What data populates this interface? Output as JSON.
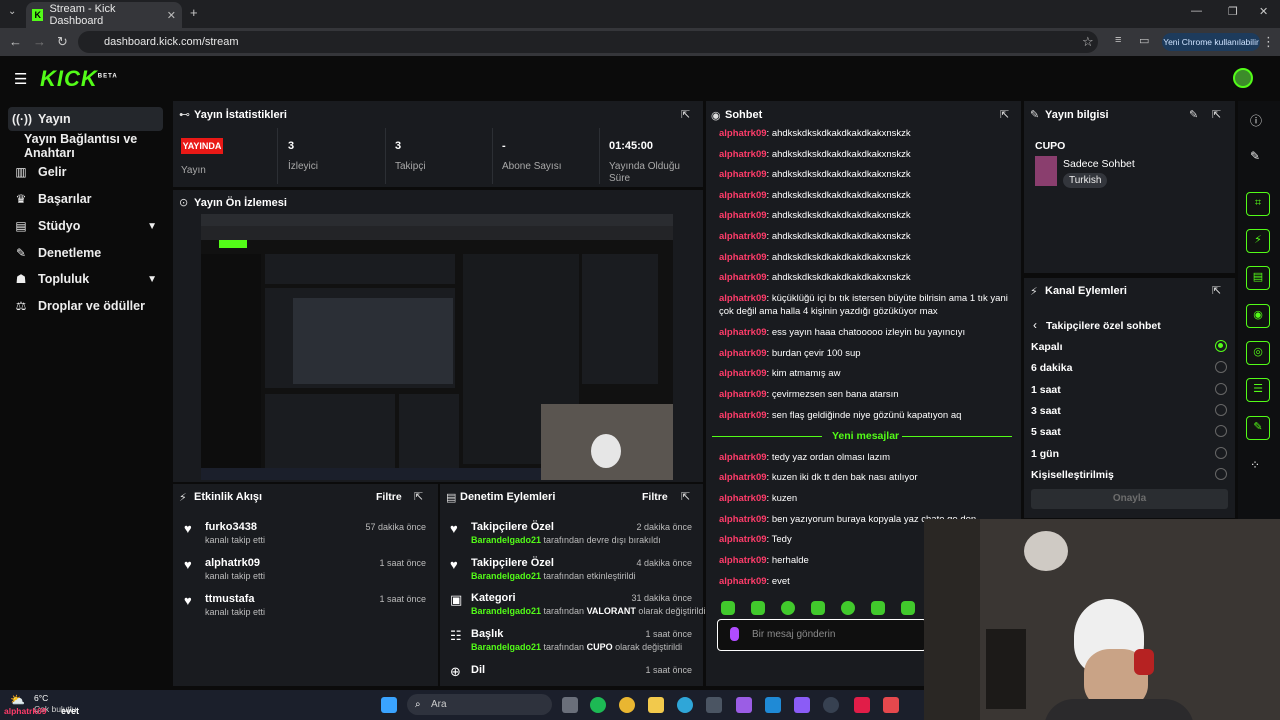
{
  "browser": {
    "tab_title": "Stream - Kick Dashboard",
    "url": "dashboard.kick.com/stream",
    "profile_label": "Yeni Chrome kullanılabilir"
  },
  "brand": {
    "logo": "KICK",
    "beta": "BETA",
    "accent": "#53fc18"
  },
  "sidebar": {
    "items": [
      {
        "label": "Yayın",
        "icon": "broadcast-icon",
        "active": true
      },
      {
        "label": "Yayın Bağlantısı ve Anahtarı",
        "icon": "",
        "active": false
      },
      {
        "label": "Gelir",
        "icon": "revenue-icon",
        "active": false
      },
      {
        "label": "Başarılar",
        "icon": "trophy-icon",
        "active": false
      },
      {
        "label": "Stüdyo",
        "icon": "studio-icon",
        "active": false,
        "expandable": true
      },
      {
        "label": "Denetleme",
        "icon": "wrench-icon",
        "active": false
      },
      {
        "label": "Topluluk",
        "icon": "community-icon",
        "active": false,
        "expandable": true
      },
      {
        "label": "Droplar ve ödüller",
        "icon": "drops-icon",
        "active": false
      }
    ]
  },
  "stats": {
    "title": "Yayın İstatistikleri",
    "live_badge": "YAYINDA",
    "items": [
      {
        "value": "",
        "label": "Yayın"
      },
      {
        "value": "3",
        "label": "İzleyici"
      },
      {
        "value": "3",
        "label": "Takipçi"
      },
      {
        "value": "-",
        "label": "Abone Sayısı"
      },
      {
        "value": "01:45:00",
        "label": "Yayında Olduğu Süre"
      }
    ]
  },
  "preview": {
    "title": "Yayın Ön İzlemesi"
  },
  "activity": {
    "title": "Etkinlik Akışı",
    "filter": "Filtre",
    "items": [
      {
        "name": "furko3438",
        "sub": "kanalı takip etti",
        "time": "57 dakika önce"
      },
      {
        "name": "alphatrk09",
        "sub": "kanalı takip etti",
        "time": "1 saat önce"
      },
      {
        "name": "ttmustafa",
        "sub": "kanalı takip etti",
        "time": "1 saat önce"
      }
    ]
  },
  "moderation": {
    "title": "Denetim Eylemleri",
    "filter": "Filtre",
    "items": [
      {
        "name": "Takipçilere Özel",
        "actor": "Barandelgado21",
        "rest": " tarafından devre dışı bırakıldı",
        "time": "2 dakika önce"
      },
      {
        "name": "Takipçilere Özel",
        "actor": "Barandelgado21",
        "rest": " tarafından etkinleştirildi",
        "time": "4 dakika önce"
      },
      {
        "name": "Kategori",
        "actor": "Barandelgado21",
        "rest": " tarafından ",
        "value": "VALORANT",
        "rest2": " olarak değiştirildi",
        "time": "31 dakika önce"
      },
      {
        "name": "Başlık",
        "actor": "Barandelgado21",
        "rest": " tarafından ",
        "value": "CUPO",
        "rest2": " olarak değiştirildi",
        "time": "1 saat önce"
      },
      {
        "name": "Dil",
        "actor": "",
        "rest": "",
        "time": "1 saat önce"
      }
    ]
  },
  "chat": {
    "title": "Sohbet",
    "new_messages": "Yeni mesajlar",
    "placeholder": "Bir mesaj gönderin",
    "messages": [
      {
        "user": "alphatrk09",
        "text": "ahdkskdkskdkakdkakdkakxnskzk"
      },
      {
        "user": "alphatrk09",
        "text": "ahdkskdkskdkakdkakdkakxnskzk"
      },
      {
        "user": "alphatrk09",
        "text": "ahdkskdkskdkakdkakdkakxnskzk"
      },
      {
        "user": "alphatrk09",
        "text": "ahdkskdkskdkakdkakdkakxnskzk"
      },
      {
        "user": "alphatrk09",
        "text": "ahdkskdkskdkakdkakdkakxnskzk"
      },
      {
        "user": "alphatrk09",
        "text": "ahdkskdkskdkakdkakdkakxnskzk"
      },
      {
        "user": "alphatrk09",
        "text": "ahdkskdkskdkakdkakdkakxnskzk"
      },
      {
        "user": "alphatrk09",
        "text": "ahdkskdkskdkakdkakdkakxnskzk"
      },
      {
        "user": "alphatrk09",
        "text": "küçüklüğü içi bı tık istersen büyüte bilrisin ama 1 tık yani çok değil ama halla 4 kişinin yazdığı gözüküyor max"
      },
      {
        "user": "alphatrk09",
        "text": "ess yayın haaa chatooooo izleyin bu yayıncıyı"
      },
      {
        "user": "alphatrk09",
        "text": "burdan çevir 100 sup"
      },
      {
        "user": "alphatrk09",
        "text": "kim atmamış aw"
      },
      {
        "user": "alphatrk09",
        "text": "çevirmezsen sen bana atarsın"
      },
      {
        "user": "alphatrk09",
        "text": "sen flaş geldiğinde niye gözünü kapatıyon aq"
      },
      {
        "user": "alphatrk09",
        "text": "tedy yaz ordan olması lazım"
      },
      {
        "user": "alphatrk09",
        "text": "kuzen iki dk tt den bak nası atılıyor"
      },
      {
        "user": "alphatrk09",
        "text": "kuzen"
      },
      {
        "user": "alphatrk09",
        "text": "ben yazıyorum buraya kopyala yaz chate ge den"
      },
      {
        "user": "alphatrk09",
        "text": "Tedy"
      },
      {
        "user": "alphatrk09",
        "text": "herhalde"
      },
      {
        "user": "alphatrk09",
        "text": "evet"
      }
    ]
  },
  "stream_info": {
    "title": "Yayın bilgisi",
    "stream_title": "CUPO",
    "category": "Sadece Sohbet",
    "tag": "Turkish"
  },
  "channel_actions": {
    "title": "Kanal Eylemleri",
    "back_label": "Takipçilere özel sohbet",
    "options": [
      {
        "label": "Kapalı",
        "selected": true
      },
      {
        "label": "6 dakika",
        "selected": false
      },
      {
        "label": "1 saat",
        "selected": false
      },
      {
        "label": "3 saat",
        "selected": false
      },
      {
        "label": "5 saat",
        "selected": false
      },
      {
        "label": "1 gün",
        "selected": false
      },
      {
        "label": "Kişiselleştirilmiş",
        "selected": false
      }
    ],
    "approve": "Onayla"
  },
  "taskbar": {
    "search_placeholder": "Ara",
    "weather_temp": "6°C",
    "weather_text": "Çok bulutlu",
    "overlay_user": "alphatrk09",
    "overlay_text": "evet"
  }
}
